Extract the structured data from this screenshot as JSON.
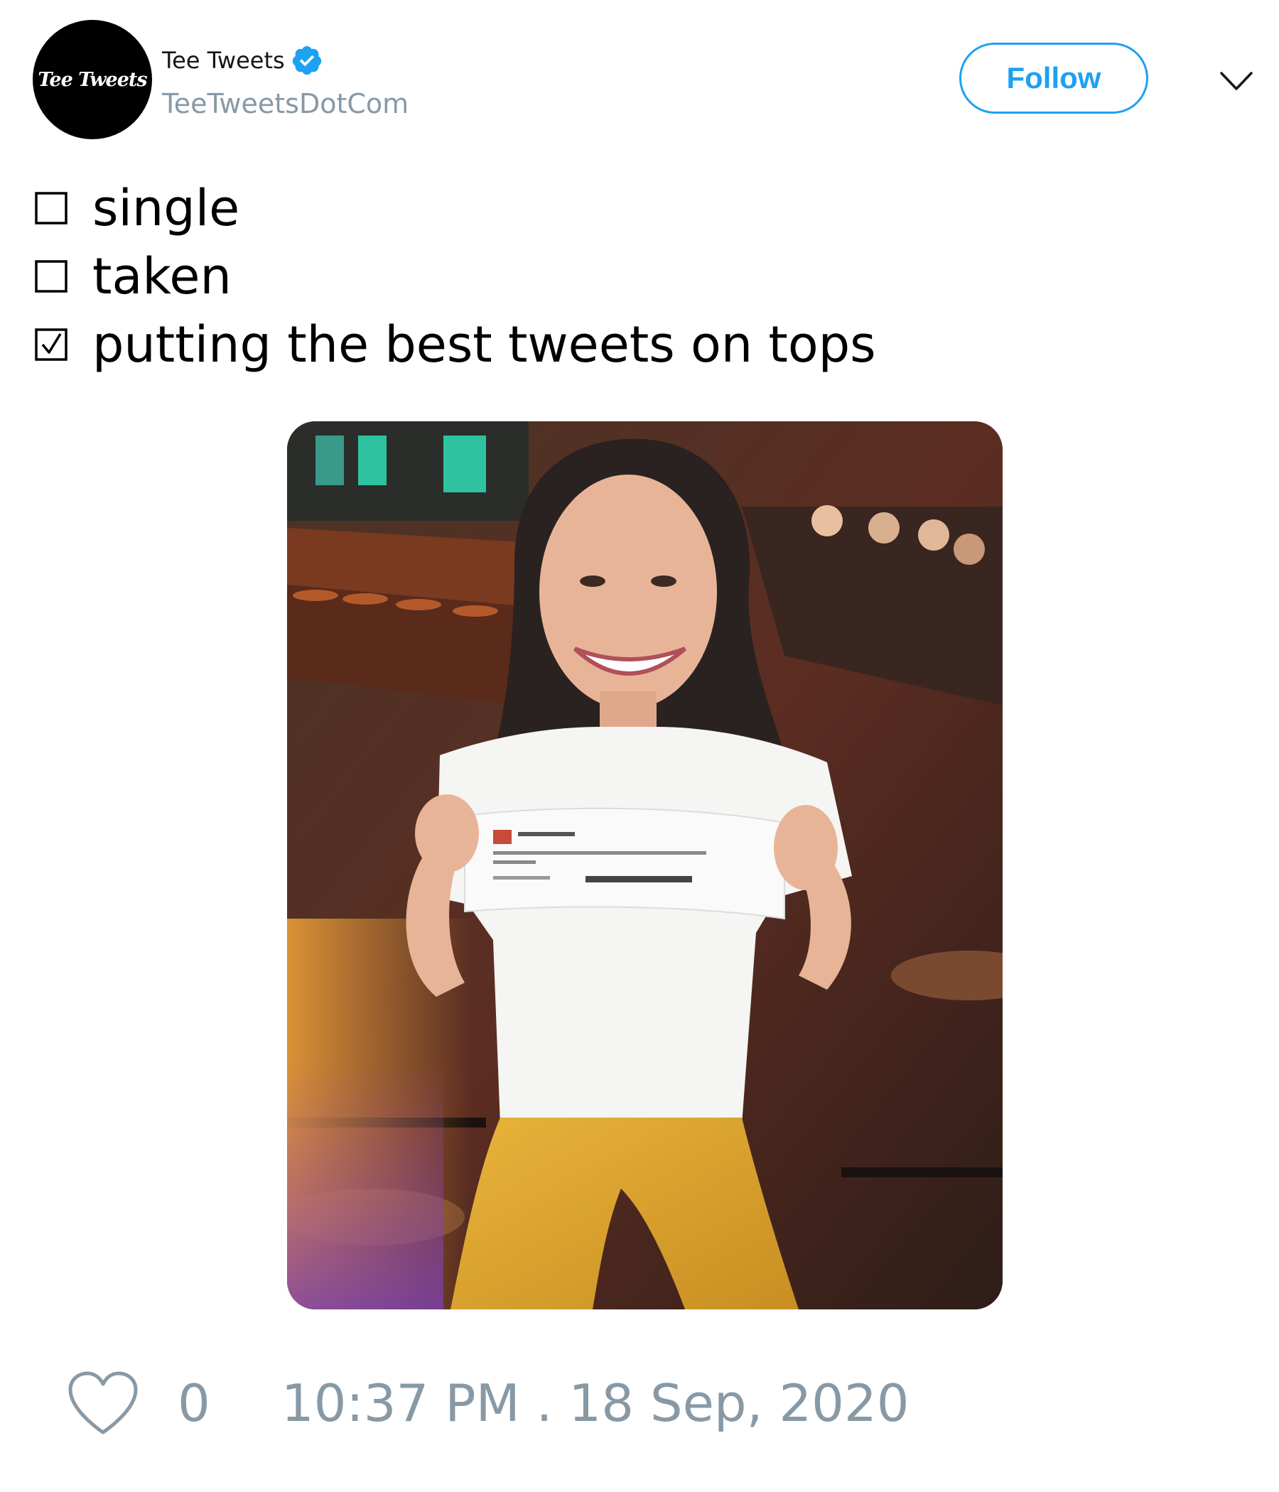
{
  "tweet": {
    "author": {
      "avatar_text": "Tee Tweets",
      "display_name": "Tee Tweets",
      "handle": "TeeTweetsDotCom",
      "verified": true
    },
    "follow_label": "Follow",
    "lines": [
      {
        "checked": false,
        "symbol": "☐",
        "text": "single"
      },
      {
        "checked": false,
        "symbol": "☐",
        "text": "taken"
      },
      {
        "checked": true,
        "symbol": "☑",
        "text": "putting the best tweets on tops"
      }
    ],
    "like_count": "0",
    "timestamp": "10:37 PM . 18 Sep, 2020"
  },
  "colors": {
    "accent": "#1da1f2",
    "muted": "#8899a6",
    "text": "#000000"
  },
  "icons": {
    "verified": "verified-badge-icon",
    "more": "chevron-down-icon",
    "like": "heart-outline-icon"
  }
}
